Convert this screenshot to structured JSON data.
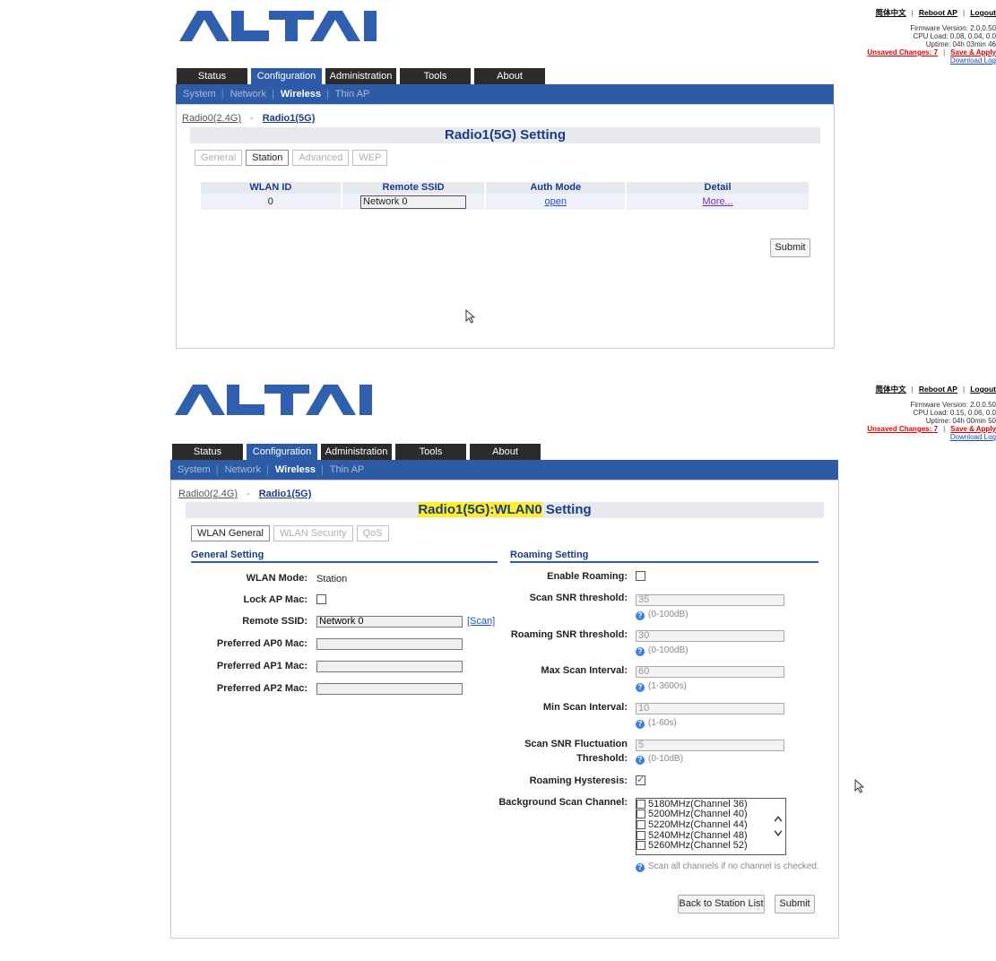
{
  "brand": "ALTAI",
  "toplinks1": {
    "lang": "简体中文",
    "reboot": "Reboot AP",
    "logout": "Logout",
    "firmware": "Firmware Version: 2.0.0.50",
    "cpu": "CPU Load: 0.08, 0.04, 0.0",
    "uptime": "Uptime: 04h 03min 46",
    "unsaved": "Unsaved Changes: 7",
    "save": "Save & Apply",
    "download": "Download Log"
  },
  "toplinks2": {
    "lang": "简体中文",
    "reboot": "Reboot AP",
    "logout": "Logout",
    "firmware": "Firmware Version: 2.0.0.50",
    "cpu": "CPU Load: 0.15, 0.06, 0.0",
    "uptime": "Uptime: 04h 00min 50",
    "unsaved": "Unsaved Changes: 7",
    "save": "Save & Apply",
    "download": "Download Log"
  },
  "main_tabs": [
    "Status",
    "Configuration",
    "Administration",
    "Tools",
    "About"
  ],
  "sub_nav": [
    "System",
    "Network",
    "Wireless",
    "Thin AP"
  ],
  "radio_links": {
    "r0": "Radio0(2.4G)",
    "dash": "-",
    "r1": "Radio1(5G)"
  },
  "screen1": {
    "title": "Radio1(5G) Setting",
    "tabs": [
      "General",
      "Station",
      "Advanced",
      "WEP"
    ],
    "table": {
      "headers": [
        "WLAN ID",
        "Remote SSID",
        "Auth Mode",
        "Detail"
      ],
      "rows": [
        {
          "id": "0",
          "ssid": "Network 0",
          "auth": "open",
          "detail": "More..."
        }
      ]
    },
    "submit": "Submit"
  },
  "screen2": {
    "title_highlight": "Radio1(5G):WLAN0",
    "title_rest": " Setting",
    "tabs": [
      "WLAN General",
      "WLAN Security",
      "QoS"
    ],
    "general": {
      "heading": "General Setting",
      "wlan_mode_label": "WLAN Mode:",
      "wlan_mode_value": "Station",
      "lock_ap_label": "Lock AP Mac:",
      "remote_ssid_label": "Remote SSID:",
      "remote_ssid_value": "Network 0",
      "scan": "[Scan]",
      "pref0": "Preferred AP0 Mac:",
      "pref1": "Preferred AP1 Mac:",
      "pref2": "Preferred AP2 Mac:"
    },
    "roaming": {
      "heading": "Roaming Setting",
      "enable_label": "Enable Roaming:",
      "scan_snr_label": "Scan SNR threshold:",
      "scan_snr_value": "35",
      "scan_snr_hint": "(0-100dB)",
      "roam_snr_label": "Roaming SNR threshold:",
      "roam_snr_value": "30",
      "roam_snr_hint": "(0-100dB)",
      "max_scan_label": "Max Scan Interval:",
      "max_scan_value": "60",
      "max_scan_hint": "(1-3600s)",
      "min_scan_label": "Min Scan Interval:",
      "min_scan_value": "10",
      "min_scan_hint": "(1-60s)",
      "fluct_label1": "Scan SNR Fluctuation",
      "fluct_label2": "Threshold:",
      "fluct_value": "5",
      "fluct_hint": "(0-10dB)",
      "hysteresis_label": "Roaming Hysteresis:",
      "hysteresis_checked": true,
      "bg_scan_label": "Background Scan Channel:",
      "channels": [
        "5180MHz(Channel 36)",
        "5200MHz(Channel 40)",
        "5220MHz(Channel 44)",
        "5240MHz(Channel 48)",
        "5260MHz(Channel 52)"
      ],
      "scan_all_hint": "Scan all channels if no channel is checked."
    },
    "back_button": "Back to Station List",
    "submit": "Submit"
  }
}
